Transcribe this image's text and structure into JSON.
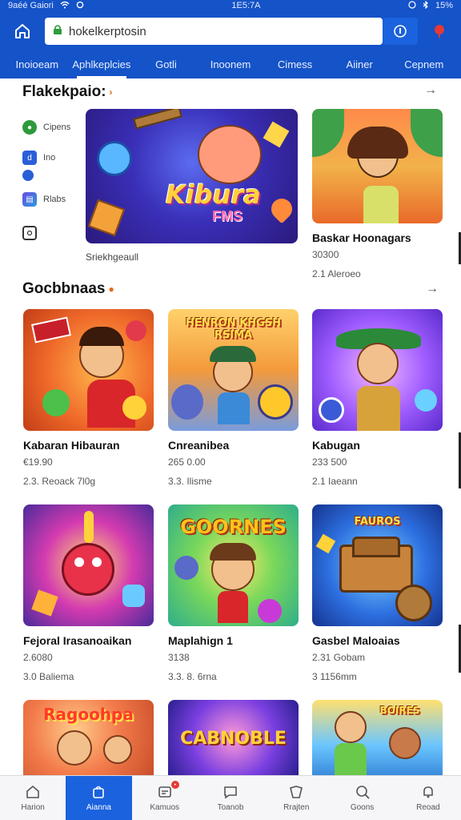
{
  "status": {
    "left": "9aéé Gaiori",
    "time": "1E5:7A",
    "battery": "15%"
  },
  "header": {
    "url": "hokelkerptosin",
    "tabs": [
      "Inoioeam",
      "Aphlkeplcies",
      "Gotli",
      "Inoonem",
      "Cimess",
      "Aiiner",
      "Cepnem"
    ]
  },
  "section1": {
    "title": "Flakekpaio:",
    "side_items": [
      "Cipens",
      "Ino",
      "",
      "Rlabs",
      ""
    ],
    "banner_logo": "Kibura",
    "banner_sub": "FMS",
    "banner_caption": "Sriekhgeaull",
    "card": {
      "name": "Baskar Hoonagars",
      "meta1": "30300",
      "meta2": "2.1 Aleroeo"
    }
  },
  "section2": {
    "title": "Gocbbnaas",
    "rows": [
      [
        {
          "name": "Kabaran Hibauran",
          "meta1": "€19.90",
          "meta2": "2.3. Reoack 7l0g",
          "thumb_text": ""
        },
        {
          "name": "Cnreanibea",
          "meta1": "265 0.00",
          "meta2": "3.3. Ilisme",
          "thumb_text": "HENRON KHGSH RSIMA"
        },
        {
          "name": "Kabugan",
          "meta1": "233 500",
          "meta2": "2.1 Iaeann",
          "thumb_text": ""
        }
      ],
      [
        {
          "name": "Fejoral Irasanoaikan",
          "meta1": "2.6080",
          "meta2": "3.0 Baliema",
          "thumb_text": ""
        },
        {
          "name": "Maplahign 1",
          "meta1": "3138",
          "meta2": "3.3. 8. 6rna",
          "thumb_text": "GOORNES"
        },
        {
          "name": "Gasbel Maloaias",
          "meta1": "2.31 Gobam",
          "meta2": "3 1156mm",
          "thumb_text": "FAUROS"
        }
      ],
      [
        {
          "thumb_text": "Ragoohpa"
        },
        {
          "thumb_text": "CABNOBLE"
        },
        {
          "thumb_text": "BOIRES"
        }
      ]
    ]
  },
  "bottom_nav": [
    "Harion",
    "Aianna",
    "Kamuos",
    "Toanob",
    "Rrajten",
    "Goons",
    "Reoad"
  ]
}
